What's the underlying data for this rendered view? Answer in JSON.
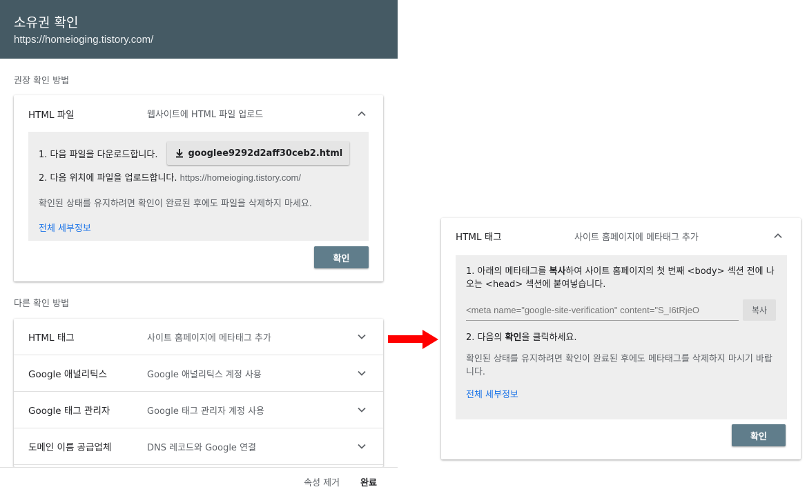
{
  "dialog": {
    "title": "소유권 확인",
    "url": "https://homeioging.tistory.com/"
  },
  "recommended_label": "권장 확인 방법",
  "other_label": "다른 확인 방법",
  "html_file": {
    "name": "HTML 파일",
    "description": "웹사이트에 HTML 파일 업로드",
    "step1": "1. 다음 파일을 다운로드합니다.",
    "download_filename": "googlee9292d2aff30ceb2.html",
    "step2_prefix": "2. 다음 위치에 파일을 업로드합니다.",
    "step2_url": "https://homeioging.tistory.com/",
    "keep_note": "확인된 상태를 유지하려면 확인이 완료된 후에도 파일을 삭제하지 마세요.",
    "details_link": "전체 세부정보",
    "confirm_button": "확인"
  },
  "other_methods": [
    {
      "name": "HTML 태그",
      "description": "사이트 홈페이지에 메타태그 추가"
    },
    {
      "name": "Google 애널리틱스",
      "description": "Google 애널리틱스 계정 사용"
    },
    {
      "name": "Google 태그 관리자",
      "description": "Google 태그 관리자 계정 사용"
    },
    {
      "name": "도메인 이름 공급업체",
      "description": "DNS 레코드와 Google 연결"
    }
  ],
  "footer": {
    "remove_property": "속성 제거",
    "done": "완료"
  },
  "html_tag_expanded": {
    "name": "HTML 태그",
    "description": "사이트 홈페이지에 메타태그 추가",
    "step1_a": "1. 아래의 메타태그를 ",
    "step1_bold": "복사",
    "step1_b": "하여 사이트 홈페이지의 첫 번째 <body> 섹션 전에 나오는 <head> 섹션에 붙여넣습니다.",
    "meta_value": "<meta name=\"google-site-verification\" content=\"S_I6tRjeO",
    "copy_button": "복사",
    "step2_a": "2. 다음의 ",
    "step2_bold": "확인",
    "step2_b": "을 클릭하세요.",
    "keep_note": "확인된 상태를 유지하려면 확인이 완료된 후에도 메타태그를 삭제하지 마시기 바랍니다.",
    "details_link": "전체 세부정보",
    "confirm_button": "확인"
  },
  "colors": {
    "header": "#455a64",
    "button": "#607d8b",
    "link": "#1a73e8",
    "arrow": "#ff0000"
  }
}
